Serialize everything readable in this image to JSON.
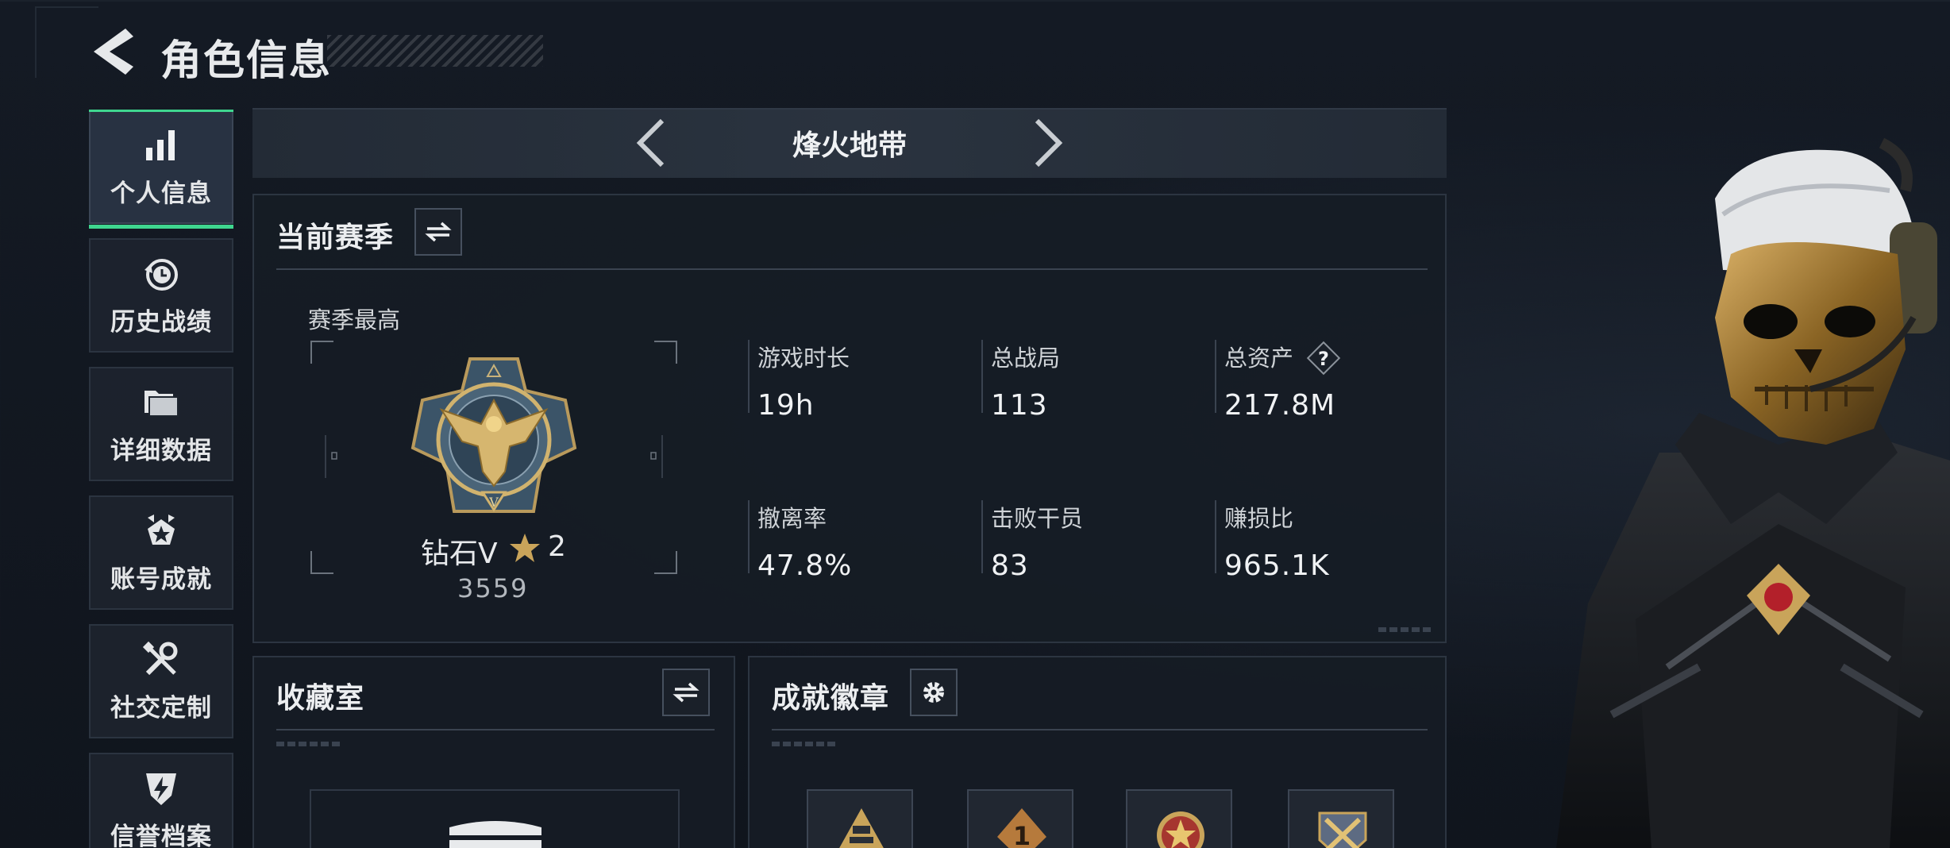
{
  "header": {
    "title": "角色信息",
    "back_icon": "back-arrow-icon"
  },
  "nav": {
    "items": [
      {
        "label": "个人信息",
        "icon": "bar-chart-icon",
        "active": true
      },
      {
        "label": "历史战绩",
        "icon": "history-clock-icon",
        "active": false
      },
      {
        "label": "详细数据",
        "icon": "folder-icon",
        "active": false
      },
      {
        "label": "账号成就",
        "icon": "achievement-star-icon",
        "active": false
      },
      {
        "label": "社交定制",
        "icon": "tools-icon",
        "active": false
      },
      {
        "label": "信誉档案",
        "icon": "shield-lightning-icon",
        "active": false
      }
    ]
  },
  "mode": {
    "title": "烽火地带"
  },
  "season": {
    "title": "当前赛季",
    "best_label": "赛季最高",
    "rank": {
      "name": "钻石V",
      "stars": "2",
      "points": "3559"
    },
    "stats": [
      {
        "label": "游戏时长",
        "value": "19h"
      },
      {
        "label": "总战局",
        "value": "113"
      },
      {
        "label": "总资产",
        "value": "217.8M"
      },
      {
        "label": "撤离率",
        "value": "47.8%"
      },
      {
        "label": "击败干员",
        "value": "83"
      },
      {
        "label": "赚损比",
        "value": "965.1K"
      }
    ]
  },
  "collection": {
    "title": "收藏室"
  },
  "badges": {
    "title": "成就徽章"
  },
  "colors": {
    "accent": "#3fd68f",
    "panel_bg": "#161c25",
    "gold": "#c9a45a"
  }
}
